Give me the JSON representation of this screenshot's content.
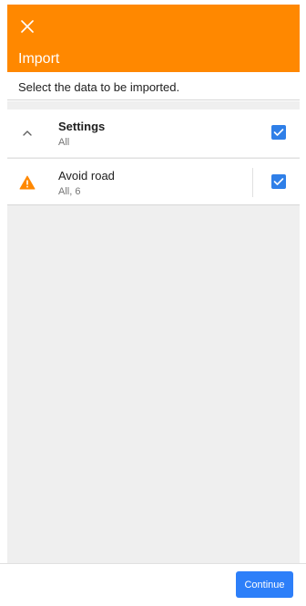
{
  "header": {
    "title": "Import",
    "background": "#ff8800",
    "close_icon": "close-icon"
  },
  "description": "Select the data to be imported.",
  "items": [
    {
      "title": "Settings",
      "subtitle": "All",
      "icon": "chevron-up-icon",
      "checked": true
    },
    {
      "title": "Avoid road",
      "subtitle": "All, 6",
      "icon": "warning-icon",
      "icon_color": "#ff8800",
      "checked": true
    }
  ],
  "footer": {
    "continue_label": "Continue",
    "accent": "#2d7ff9"
  }
}
